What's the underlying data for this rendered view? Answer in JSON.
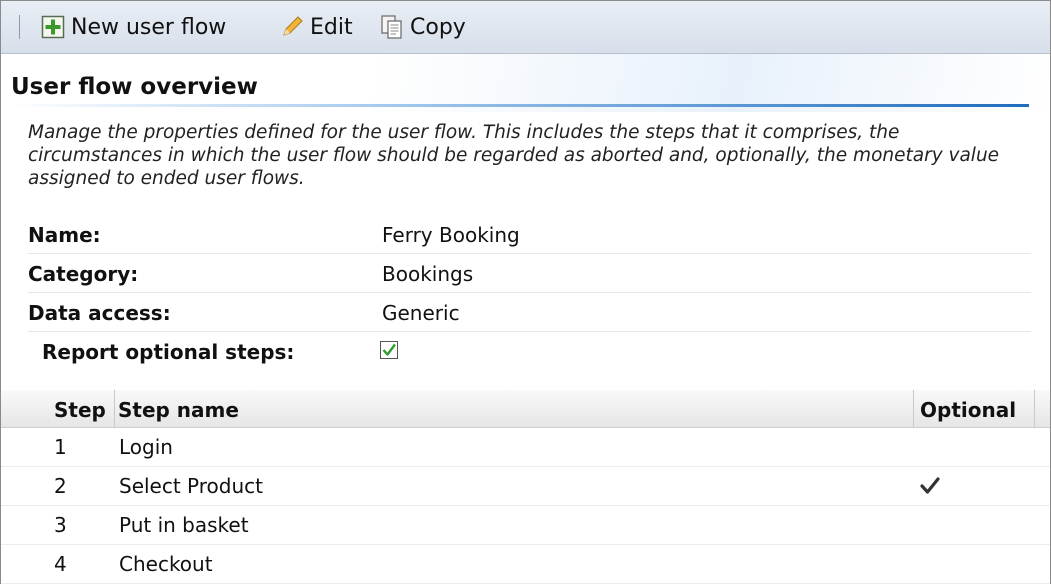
{
  "toolbar": {
    "new_label": "New user flow",
    "edit_label": "Edit",
    "copy_label": "Copy",
    "icons": {
      "new": "add-icon",
      "edit": "pencil-icon",
      "copy": "copy-icon"
    }
  },
  "page": {
    "title": "User flow overview",
    "description": "Manage the properties defined for the user flow. This includes the steps that it comprises, the circumstances in which the user flow should be regarded as aborted and, optionally, the monetary value assigned to ended user flows."
  },
  "properties": {
    "name_label": "Name:",
    "name_value": "Ferry Booking",
    "category_label": "Category:",
    "category_value": "Bookings",
    "data_access_label": "Data access:",
    "data_access_value": "Generic",
    "report_optional_label": "Report optional steps:",
    "report_optional_checked": true
  },
  "steps_table": {
    "columns": [
      "Step",
      "Step name",
      "Optional"
    ],
    "rows": [
      {
        "step": "1",
        "name": "Login",
        "optional": false
      },
      {
        "step": "2",
        "name": "Select Product",
        "optional": true
      },
      {
        "step": "3",
        "name": "Put in basket",
        "optional": false
      },
      {
        "step": "4",
        "name": "Checkout",
        "optional": false
      }
    ]
  },
  "colors": {
    "accent": "#1f6cbd",
    "check_green": "#2e9d2e"
  }
}
